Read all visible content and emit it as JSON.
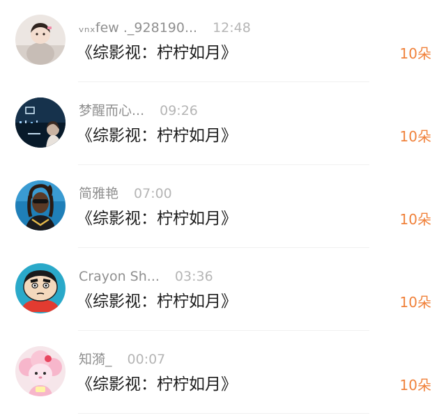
{
  "comments": [
    {
      "name": "ᵥₙₓfew ._928190...",
      "time": "12:48",
      "message": "《综影视：柠柠如月》",
      "gift": "10朵"
    },
    {
      "name": "梦醒而心...",
      "time": "09:26",
      "message": "《综影视：柠柠如月》",
      "gift": "10朵"
    },
    {
      "name": "简雅艳",
      "time": "07:00",
      "message": "《综影视：柠柠如月》",
      "gift": "10朵"
    },
    {
      "name": "Crayon Sh...",
      "time": "03:36",
      "message": "《综影视：柠柠如月》",
      "gift": "10朵"
    },
    {
      "name": "知漪_",
      "time": "00:07",
      "message": "《综影视：柠柠如月》",
      "gift": "10朵"
    }
  ],
  "colors": {
    "name": "#8f8f8f",
    "time": "#b5b5b5",
    "message": "#1c1c1c",
    "gift": "#f0813a",
    "divider": "#f0f0f0"
  }
}
